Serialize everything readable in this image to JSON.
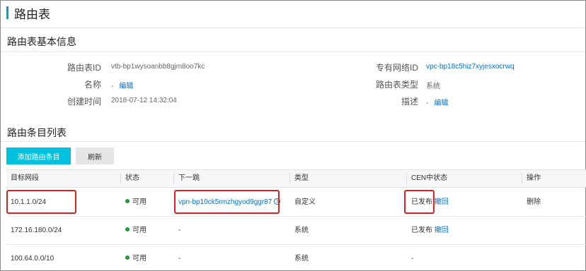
{
  "page": {
    "title": "路由表"
  },
  "basic_info": {
    "section_title": "路由表基本信息",
    "left": [
      {
        "label": "路由表ID",
        "value": "vtb-bp1wysoanbb8gjm8oo7kc"
      },
      {
        "label": "名称",
        "value": "-",
        "link": "编辑"
      },
      {
        "label": "创建时间",
        "value": "2018-07-12 14:32:04"
      }
    ],
    "right": [
      {
        "label": "专有网络ID",
        "value": "vpc-bp18c5hiz7xyjesxocrwq"
      },
      {
        "label": "路由表类型",
        "value": "系统"
      },
      {
        "label": "描述",
        "value": "-",
        "link": "编辑"
      }
    ]
  },
  "entries": {
    "section_title": "路由条目列表",
    "add_button": "添加路由条目",
    "refresh_button": "刷新",
    "columns": [
      "目标网段",
      "状态",
      "下一跳",
      "类型",
      "CEN中状态",
      "操作"
    ],
    "rows": [
      {
        "cidr": "10.1.1.0/24",
        "status": "可用",
        "next_hop": "vpn-bp10ck5rmzhgyod9ggr87",
        "type": "自定义",
        "cen_status": "已发布",
        "cen_action": "撤回",
        "op": "删除"
      },
      {
        "cidr": "172.16.180.0/24",
        "status": "可用",
        "next_hop": "-",
        "type": "系统",
        "cen_status": "已发布",
        "cen_action": "撤回",
        "op": ""
      },
      {
        "cidr": "100.64.0.0/10",
        "status": "可用",
        "next_hop": "-",
        "type": "系统",
        "cen_status": "-",
        "cen_action": "",
        "op": ""
      }
    ]
  },
  "colors": {
    "accent": "#00c1de",
    "link": "#0070cc",
    "status_ok": "#1e9c3a",
    "highlight": "#e02020"
  }
}
